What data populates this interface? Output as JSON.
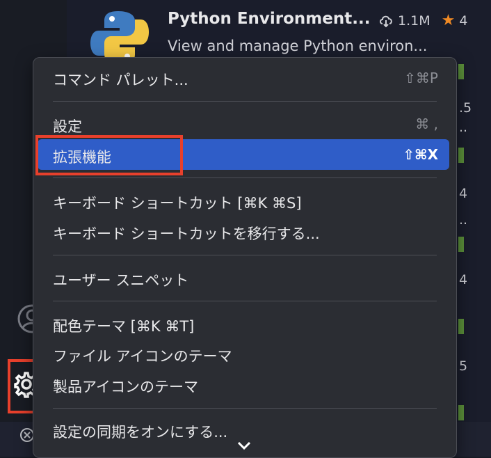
{
  "extension": {
    "name": "Python Environment...",
    "description": "View and manage Python environ...",
    "downloads": "1.1M",
    "rating": "4",
    "colors": {
      "python_blue": "#3f7bc0",
      "python_yellow": "#f2c744"
    }
  },
  "side_fragments": [
    ".5",
    "4",
    "4",
    "5"
  ],
  "side_ellipses": [
    "..",
    ".."
  ],
  "menu": {
    "items": [
      {
        "label": "コマンド パレット...",
        "shortcut": "⇧⌘P"
      },
      {
        "label": "設定",
        "shortcut": "⌘ ,"
      },
      {
        "label": "拡張機能",
        "shortcut": "⇧⌘X",
        "selected": true
      },
      {
        "label": "キーボード ショートカット [⌘K ⌘S]",
        "shortcut": ""
      },
      {
        "label": "キーボード ショートカットを移行する...",
        "shortcut": ""
      },
      {
        "label": "ユーザー スニペット",
        "shortcut": ""
      },
      {
        "label": "配色テーマ [⌘K ⌘T]",
        "shortcut": ""
      },
      {
        "label": "ファイル アイコンのテーマ",
        "shortcut": ""
      },
      {
        "label": "製品アイコンのテーマ",
        "shortcut": ""
      },
      {
        "label": "設定の同期をオンにする...",
        "shortcut": ""
      }
    ]
  },
  "colors": {
    "menu_bg": "#2b2d33",
    "selection": "#2f5dc8",
    "highlight_box": "#e8402c",
    "star": "#f08a24"
  }
}
